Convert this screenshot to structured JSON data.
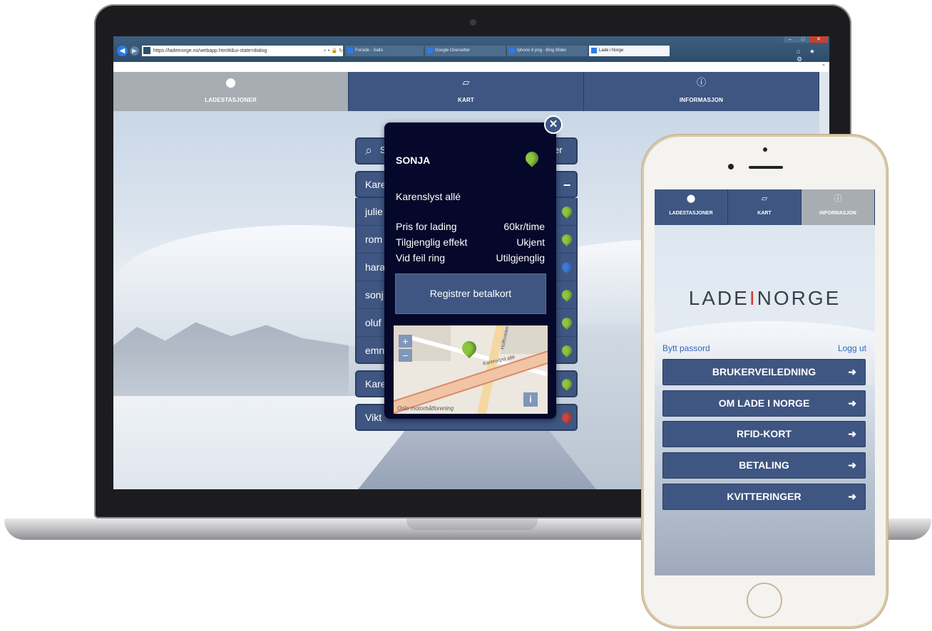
{
  "browser": {
    "url": "https://ladeinorge.no/webapp.html#&ui-state=dialog",
    "tabs": [
      "Forside - Salto",
      "Google Oversetter",
      "Iphone 6 png - Bing Bilder",
      "Lade i Norge"
    ],
    "window_controls": [
      "–",
      "□",
      "✕"
    ],
    "toolbar_icons": "⌂ ★ ⚙"
  },
  "desktop_app": {
    "tabs": [
      {
        "label": "LADESTASJONER",
        "icon": "map-pin-icon"
      },
      {
        "label": "KART",
        "icon": "map-icon"
      },
      {
        "label": "INFORMASJON",
        "icon": "info-icon"
      }
    ],
    "search": {
      "placeholder": "S",
      "filter_label": "er"
    },
    "groups": [
      {
        "label": "Kare"
      },
      {
        "label": "Kare"
      },
      {
        "label": "Vikt"
      }
    ],
    "list_items": [
      "julie",
      "rom",
      "hara",
      "sonj",
      "oluf",
      "emn"
    ],
    "popup": {
      "title": "SONJA",
      "address": "Karenslyst allé",
      "rows": [
        {
          "label": "Pris for lading",
          "value": "60kr/time"
        },
        {
          "label": "Tilgjenglig effekt",
          "value": "Ukjent"
        },
        {
          "label": "Vid feil ring",
          "value": "Utilgjenglig"
        }
      ],
      "button": "Registrer betalkort",
      "map": {
        "zoom_in": "+",
        "zoom_out": "−",
        "info": "i",
        "attribution": "Oslo motorbåtforening",
        "street": "Karenslyst allé",
        "street2": "Hoffsveien"
      }
    }
  },
  "phone_app": {
    "tabs": [
      {
        "label": "LADESTASJONER",
        "icon": "map-pin-icon"
      },
      {
        "label": "KART",
        "icon": "map-icon"
      },
      {
        "label": "INFORMASJON",
        "icon": "info-icon"
      }
    ],
    "logo": {
      "left": "LADE",
      "sep": "I",
      "right": "NORGE"
    },
    "links": {
      "change_password": "Bytt passord",
      "logout": "Logg ut"
    },
    "menu": [
      "BRUKERVEILEDNING",
      "OM LADE I NORGE",
      "RFID-KORT",
      "BETALING",
      "KVITTERINGER"
    ]
  },
  "colors": {
    "primary": "#3f5682",
    "popup_bg": "#05082a",
    "pin_green": "#8cc63f",
    "pin_blue": "#3d7bd6",
    "pin_red": "#c9463d",
    "logo_accent": "#d43a2f"
  }
}
